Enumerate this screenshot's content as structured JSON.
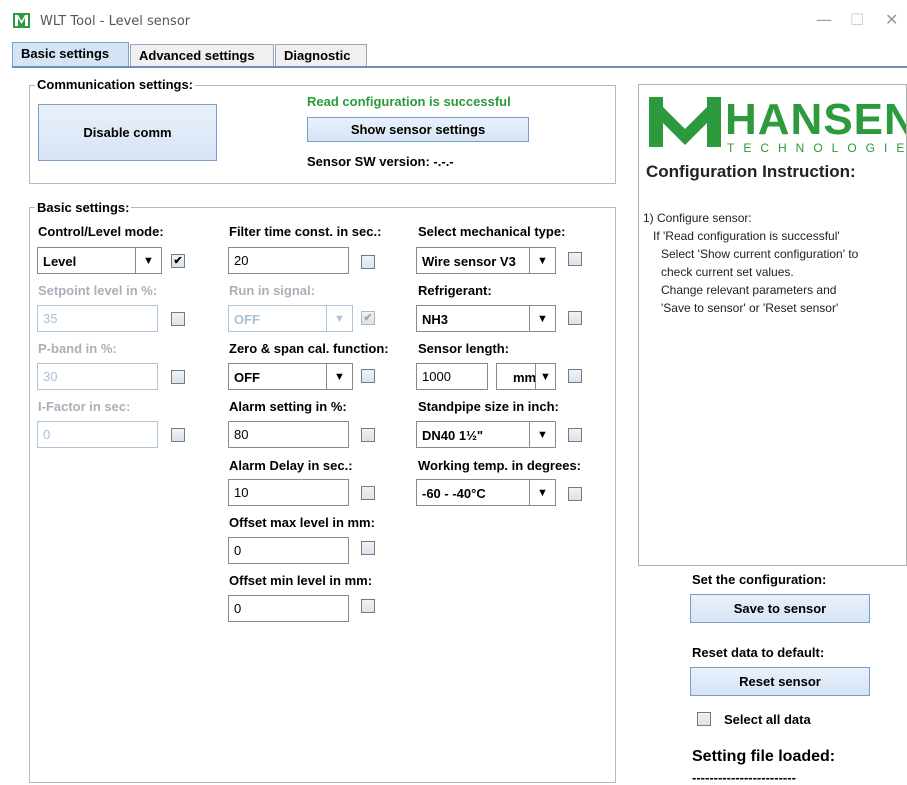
{
  "window": {
    "title": "WLT Tool - Level sensor",
    "minimize_glyph": "—",
    "maximize_glyph": "☐",
    "close_glyph": "✕"
  },
  "tabs": [
    "Basic settings",
    "Advanced settings",
    "Diagnostic"
  ],
  "communication": {
    "group_title": "Communication settings:",
    "disable_button": "Disable comm",
    "status": "Read configuration is successful",
    "show_button": "Show sensor settings",
    "sw_version": "Sensor SW version: -.-.-"
  },
  "basic": {
    "group_title": "Basic settings:",
    "col1": {
      "mode_label": "Control/Level mode:",
      "mode_value": "Level",
      "setpoint_label": "Setpoint level in %:",
      "setpoint_value": "35",
      "pband_label": "P-band in %:",
      "pband_value": "30",
      "ifactor_label": "I-Factor in sec:",
      "ifactor_value": "0"
    },
    "col2": {
      "filter_label": "Filter time const. in sec.:",
      "filter_value": "20",
      "run_label": "Run in signal:",
      "run_value": "OFF",
      "zero_label": "Zero & span cal. function:",
      "zero_value": "OFF",
      "alarm_label": "Alarm setting in %:",
      "alarm_value": "80",
      "delay_label": "Alarm Delay in sec.:",
      "delay_value": "10",
      "offmax_label": "Offset max level in mm:",
      "offmax_value": "0",
      "offmin_label": "Offset min level in mm:",
      "offmin_value": "0"
    },
    "col3": {
      "mech_label": "Select mechanical type:",
      "mech_value": "Wire sensor V3",
      "refr_label": "Refrigerant:",
      "refr_value": "NH3",
      "len_label": "Sensor length:",
      "len_value": "1000",
      "len_unit": "mm",
      "stand_label": "Standpipe size in inch:",
      "stand_value": "DN40 1½\"",
      "temp_label": "Working temp. in degrees:",
      "temp_value": "-60 - -40°C"
    }
  },
  "panel": {
    "logo": "HANSEN",
    "logo_sub": "TECHNOLOGIE",
    "heading": "Configuration Instruction:",
    "lines": [
      "1) Configure sensor:",
      "If 'Read configuration is successful'",
      "Select 'Show current configuration' to",
      "check current set values.",
      "Change relevant parameters and",
      "'Save to sensor' or 'Reset sensor'"
    ]
  },
  "actions": {
    "set_label": "Set the configuration:",
    "save_button": "Save to sensor",
    "reset_label": "Reset data to default:",
    "reset_button": "Reset sensor",
    "select_all": "Select all data",
    "file_loaded": "Setting file loaded:",
    "file_name": "------------------------"
  },
  "colors": {
    "accent_green": "#2c9a3d",
    "tab_active": "#d5e4f4"
  }
}
